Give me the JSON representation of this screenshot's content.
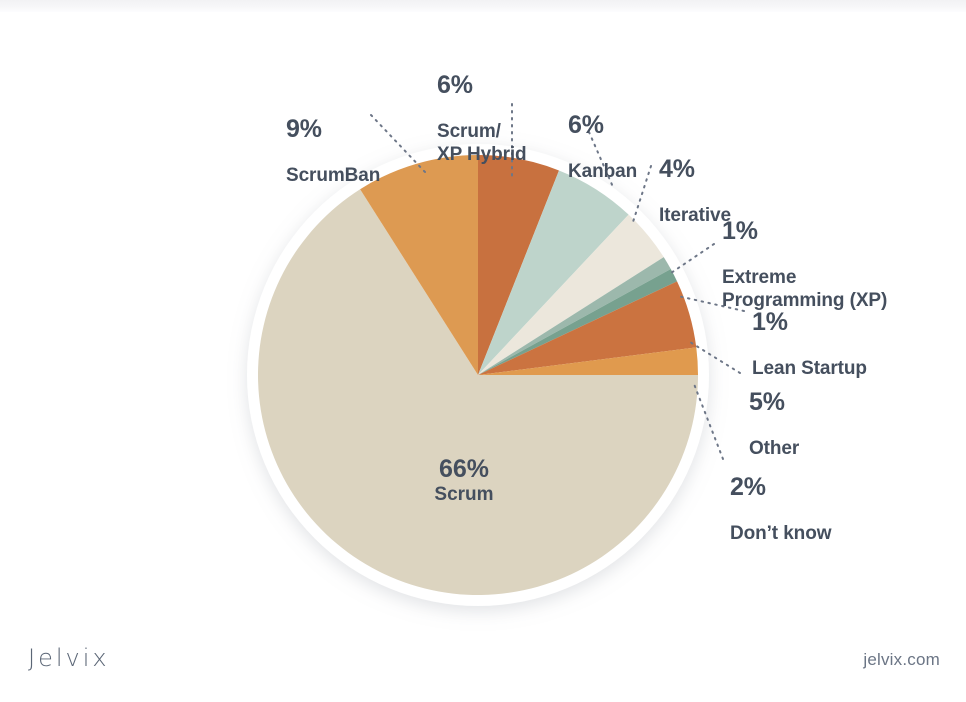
{
  "chart_data": {
    "type": "pie",
    "title": "",
    "subtitle": "",
    "xlabel": "",
    "ylabel": "",
    "legend_position": "callout-labels",
    "unit": "%",
    "categories": [
      "Scrum",
      "ScrumBan",
      "Scrum/XP Hybrid",
      "Kanban",
      "Iterative",
      "Extreme Programming (XP)",
      "Lean Startup",
      "Other",
      "Don't know"
    ],
    "values": [
      66,
      9,
      6,
      6,
      4,
      1,
      1,
      5,
      2
    ],
    "slices": [
      {
        "id": "hybrid",
        "name": "Scrum/\nXP Hybrid",
        "name_plain": "Scrum/XP Hybrid",
        "percent": "6%",
        "value": 6,
        "color": "#c8713f"
      },
      {
        "id": "kanban",
        "name": "Kanban",
        "name_plain": "Kanban",
        "percent": "6%",
        "value": 6,
        "color": "#bed4cb"
      },
      {
        "id": "iterative",
        "name": "Iterative",
        "name_plain": "Iterative",
        "percent": "4%",
        "value": 4,
        "color": "#ece7dc"
      },
      {
        "id": "xp",
        "name": "Extreme\nProgramming (XP)",
        "name_plain": "Extreme Programming (XP)",
        "percent": "1%",
        "value": 1,
        "color": "#9cb8ac"
      },
      {
        "id": "lean",
        "name": "Lean Startup",
        "name_plain": "Lean Startup",
        "percent": "1%",
        "value": 1,
        "color": "#77a18f"
      },
      {
        "id": "other",
        "name": "Other",
        "name_plain": "Other",
        "percent": "5%",
        "value": 5,
        "color": "#cb7340"
      },
      {
        "id": "dontknow",
        "name": "Don’t know",
        "name_plain": "Don’t know",
        "percent": "2%",
        "value": 2,
        "color": "#e09a4e"
      },
      {
        "id": "scrum",
        "name": "Scrum",
        "name_plain": "Scrum",
        "percent": "66%",
        "value": 66,
        "color": "#dcd4c0"
      },
      {
        "id": "scrumban",
        "name": "ScrumBan",
        "name_plain": "ScrumBan",
        "percent": "9%",
        "value": 9,
        "color": "#dd9a52"
      }
    ]
  },
  "labels": {
    "scrumban": {
      "percent": "9%",
      "name": "ScrumBan"
    },
    "hybrid": {
      "percent": "6%",
      "name": "Scrum/\nXP Hybrid"
    },
    "kanban": {
      "percent": "6%",
      "name": "Kanban"
    },
    "iterative": {
      "percent": "4%",
      "name": "Iterative"
    },
    "xp": {
      "percent": "1%",
      "name": "Extreme\nProgramming (XP)"
    },
    "lean": {
      "percent": "1%",
      "name": "Lean Startup"
    },
    "other": {
      "percent": "5%",
      "name": "Other"
    },
    "dontknow": {
      "percent": "2%",
      "name": "Don’t know"
    },
    "scrum": {
      "percent": "66%",
      "name": "Scrum"
    }
  },
  "footer": {
    "logo": "Jelvix",
    "site": "jelvix.com"
  },
  "colors": {
    "text": "#454f5e",
    "background": "#ffffff",
    "ring": "#ffffff"
  }
}
